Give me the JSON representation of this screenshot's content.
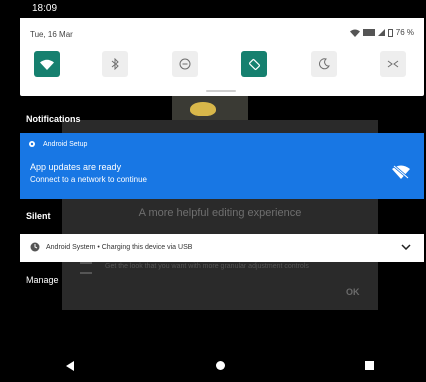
{
  "status_bar": {
    "time": "18:09"
  },
  "background_app": {
    "dialog_title": "A more helpful editing experience",
    "dialog_text": "Get the look that you want with more granular adjustment controls",
    "ok_label": "OK"
  },
  "quick_settings": {
    "date": "Tue, 16 Mar",
    "battery": "76 %",
    "tiles": [
      {
        "name": "wifi",
        "icon": "wifi-icon",
        "state": "on"
      },
      {
        "name": "bluetooth",
        "icon": "bluetooth-icon",
        "state": "off"
      },
      {
        "name": "do-not-disturb",
        "icon": "do-not-disturb-icon",
        "state": "off"
      },
      {
        "name": "auto-rotate",
        "icon": "auto-rotate-icon",
        "state": "on"
      },
      {
        "name": "night-light",
        "icon": "moon-icon",
        "state": "off"
      },
      {
        "name": "nfc",
        "icon": "nfc-icon",
        "state": "off"
      }
    ]
  },
  "sections": {
    "notifications": "Notifications",
    "silent": "Silent",
    "manage": "Manage"
  },
  "notification_setup": {
    "app": "Android Setup",
    "title": "App updates are ready",
    "text": "Connect to a network to continue",
    "action_icon": "no-wifi-icon"
  },
  "notification_system": {
    "text": "Android System • Charging this device via USB",
    "expand_icon": "chevron-down-icon"
  },
  "colors": {
    "accent_teal": "#16806f",
    "notification_blue": "#1877e4"
  }
}
